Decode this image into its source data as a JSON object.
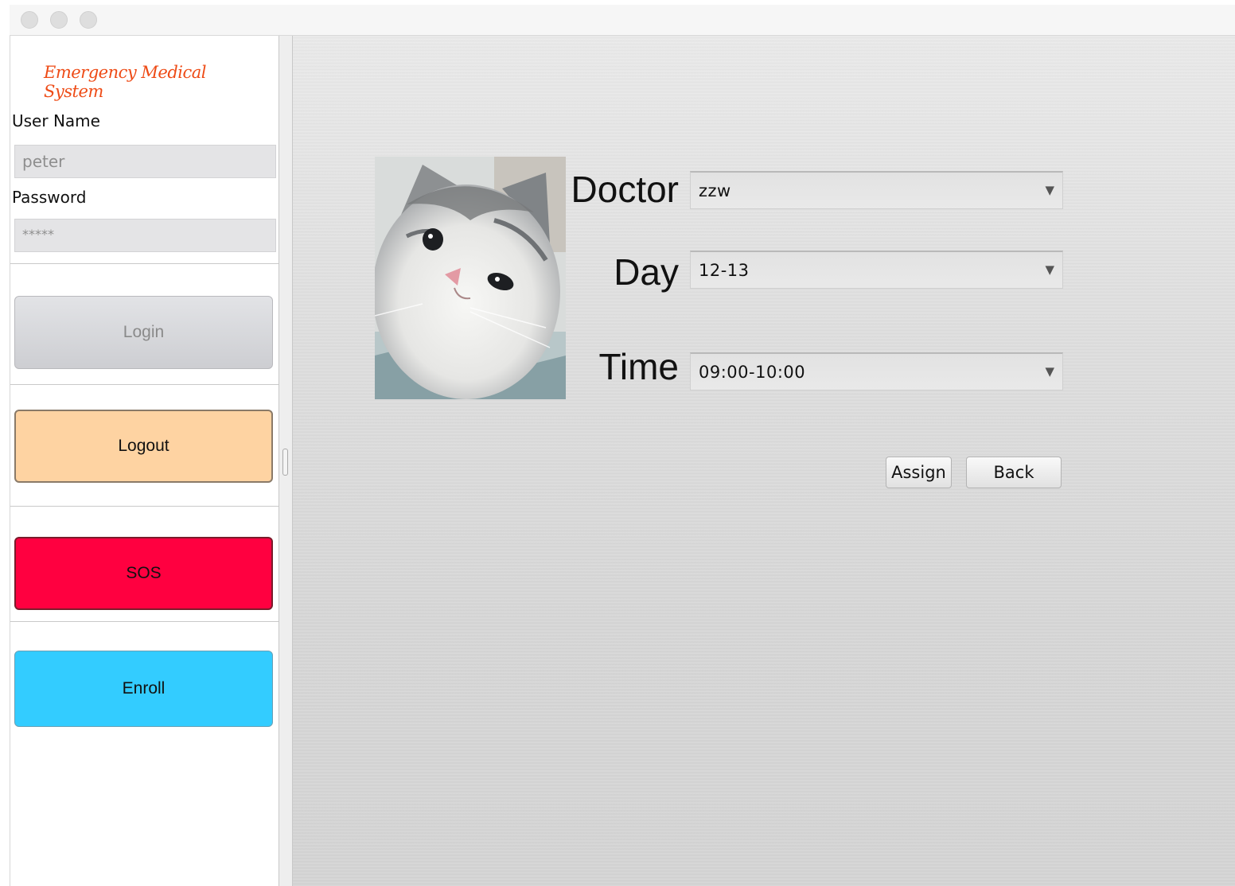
{
  "window": {
    "controls": [
      "close-icon",
      "minimize-icon",
      "zoom-icon"
    ]
  },
  "sidebar": {
    "brand": "Emergency Medical System",
    "username_label": "User Name",
    "username_value": "peter",
    "password_label": "Password",
    "password_value": "*****",
    "login_label": "Login",
    "logout_label": "Logout",
    "sos_label": "SOS",
    "enroll_label": "Enroll",
    "colors": {
      "logout": "#fed3a2",
      "sos": "#ff0040",
      "enroll": "#33ccff",
      "brand": "#ee4b16"
    }
  },
  "form": {
    "doctor_label": "Doctor",
    "doctor_value": "zzw",
    "day_label": "Day",
    "day_value": "12-13",
    "time_label": "Time",
    "time_value": "09:00-10:00",
    "assign_label": "Assign",
    "back_label": "Back",
    "dropdown_icon": "chevron-down-icon",
    "photo_subject": "kitten-photo"
  }
}
